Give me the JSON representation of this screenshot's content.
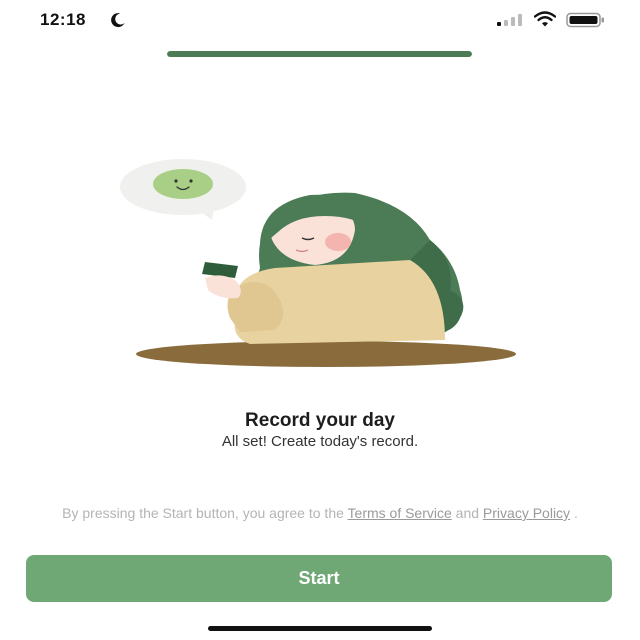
{
  "status_bar": {
    "time": "12:18",
    "icons": [
      "moon-icon",
      "signal-icon",
      "wifi-icon",
      "battery-icon"
    ]
  },
  "progress": {
    "fraction": 1.0,
    "color": "#4b7c56"
  },
  "illustration": {
    "name": "girl-with-phone-illustration",
    "colors": {
      "hair": "#4b7c56",
      "sweater": "#e8d2a0",
      "table": "#8a6c3c",
      "bubble": "#f0f1ee",
      "smiley": "#a9cf86"
    }
  },
  "content": {
    "title": "Record your day",
    "subtitle": "All set! Create today's record."
  },
  "consent": {
    "prefix": "By pressing the Start button, you agree to the ",
    "terms_link": "Terms of Service",
    "middle": " and ",
    "privacy_link": "Privacy Policy",
    "suffix": " ."
  },
  "start_button": {
    "label": "Start",
    "color": "#6fa874"
  }
}
